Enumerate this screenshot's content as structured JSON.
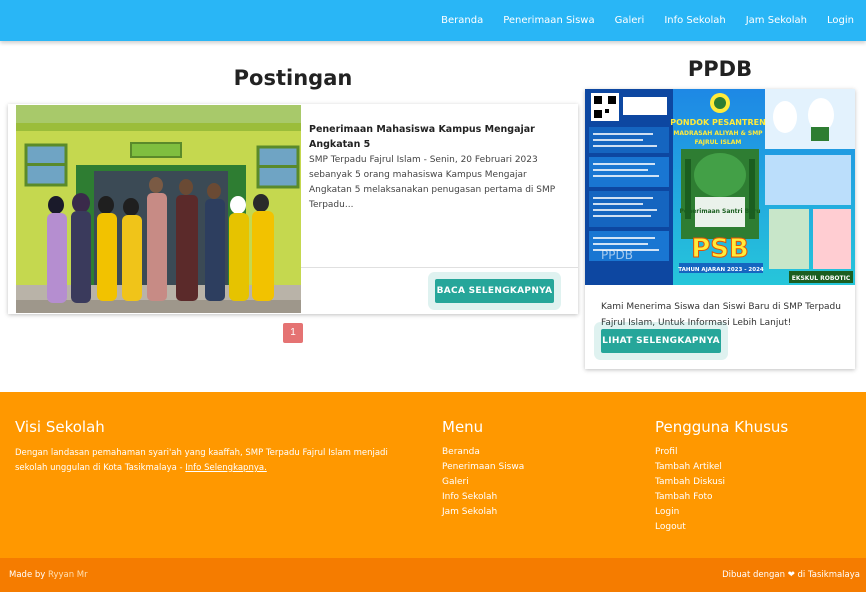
{
  "nav": {
    "items": [
      "Beranda",
      "Penerimaan Siswa",
      "Galeri",
      "Info Sekolah",
      "Jam Sekolah",
      "Login"
    ]
  },
  "posts": {
    "heading": "Postingan",
    "item": {
      "title": "Penerimaan Mahasiswa Kampus Mengajar Angkatan 5",
      "excerpt": "SMP Terpadu Fajrul Islam - Senin, 20 Februari 2023 sebanyak 5 orang mahasiswa Kampus Mengajar Angkatan 5 melaksanakan penugasan pertama di SMP Terpadu...",
      "button": "BACA SELENGKAPNYA"
    },
    "page": "1"
  },
  "ppdb": {
    "heading": "PPDB",
    "poster": {
      "title_line1": "PONDOK PESANTREN",
      "title_line2": "MADRASAH ALIYAH & SMP",
      "title_line3": "FAJRUL ISLAM",
      "subtitle": "Penerimaan Santri Baru",
      "big": "PSB",
      "year": "TAHUN AJARAN 2023 - 2024",
      "badge": "EKSKUL ROBOTIC",
      "watermark": "PPDB"
    },
    "text": "Kami Menerima Siswa dan Siswi Baru di SMP Terpadu Fajrul Islam, Untuk Informasi Lebih Lanjut!",
    "button": "LIHAT SELENGKAPNYA"
  },
  "footer": {
    "visi": {
      "title": "Visi Sekolah",
      "text": "Dengan landasan pemahaman syari'ah yang kaaffah, SMP Terpadu Fajrul Islam menjadi sekolah unggulan di Kota Tasikmalaya -",
      "link": "Info Selengkapnya."
    },
    "menu": {
      "title": "Menu",
      "items": [
        "Beranda",
        "Penerimaan Siswa",
        "Galeri",
        "Info Sekolah",
        "Jam Sekolah"
      ]
    },
    "user": {
      "title": "Pengguna Khusus",
      "items": [
        "Profil",
        "Tambah Artikel",
        "Tambah Diskusi",
        "Tambah Foto",
        "Login",
        "Logout"
      ]
    },
    "made_by_prefix": "Made by",
    "made_by_name": "Ryyan Mr",
    "made_with": "Dibuat dengan ❤ di Tasikmalaya"
  },
  "colors": {
    "navbar": "#29b6f6",
    "footer": "#ff9800",
    "footer_bottom": "#f57c00",
    "button": "#26a69a",
    "page_badge": "#e57373"
  }
}
